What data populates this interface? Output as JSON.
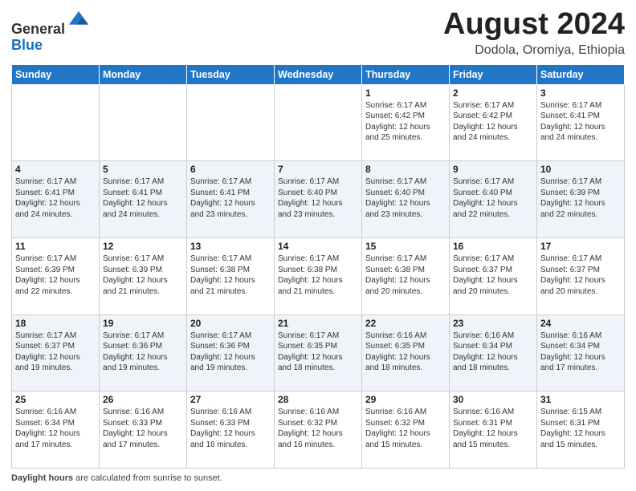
{
  "header": {
    "logo_line1": "General",
    "logo_line2": "Blue",
    "main_title": "August 2024",
    "subtitle": "Dodola, Oromiya, Ethiopia"
  },
  "weekdays": [
    "Sunday",
    "Monday",
    "Tuesday",
    "Wednesday",
    "Thursday",
    "Friday",
    "Saturday"
  ],
  "weeks": [
    [
      {
        "day": "",
        "info": ""
      },
      {
        "day": "",
        "info": ""
      },
      {
        "day": "",
        "info": ""
      },
      {
        "day": "",
        "info": ""
      },
      {
        "day": "1",
        "info": "Sunrise: 6:17 AM\nSunset: 6:42 PM\nDaylight: 12 hours\nand 25 minutes."
      },
      {
        "day": "2",
        "info": "Sunrise: 6:17 AM\nSunset: 6:42 PM\nDaylight: 12 hours\nand 24 minutes."
      },
      {
        "day": "3",
        "info": "Sunrise: 6:17 AM\nSunset: 6:41 PM\nDaylight: 12 hours\nand 24 minutes."
      }
    ],
    [
      {
        "day": "4",
        "info": "Sunrise: 6:17 AM\nSunset: 6:41 PM\nDaylight: 12 hours\nand 24 minutes."
      },
      {
        "day": "5",
        "info": "Sunrise: 6:17 AM\nSunset: 6:41 PM\nDaylight: 12 hours\nand 24 minutes."
      },
      {
        "day": "6",
        "info": "Sunrise: 6:17 AM\nSunset: 6:41 PM\nDaylight: 12 hours\nand 23 minutes."
      },
      {
        "day": "7",
        "info": "Sunrise: 6:17 AM\nSunset: 6:40 PM\nDaylight: 12 hours\nand 23 minutes."
      },
      {
        "day": "8",
        "info": "Sunrise: 6:17 AM\nSunset: 6:40 PM\nDaylight: 12 hours\nand 23 minutes."
      },
      {
        "day": "9",
        "info": "Sunrise: 6:17 AM\nSunset: 6:40 PM\nDaylight: 12 hours\nand 22 minutes."
      },
      {
        "day": "10",
        "info": "Sunrise: 6:17 AM\nSunset: 6:39 PM\nDaylight: 12 hours\nand 22 minutes."
      }
    ],
    [
      {
        "day": "11",
        "info": "Sunrise: 6:17 AM\nSunset: 6:39 PM\nDaylight: 12 hours\nand 22 minutes."
      },
      {
        "day": "12",
        "info": "Sunrise: 6:17 AM\nSunset: 6:39 PM\nDaylight: 12 hours\nand 21 minutes."
      },
      {
        "day": "13",
        "info": "Sunrise: 6:17 AM\nSunset: 6:38 PM\nDaylight: 12 hours\nand 21 minutes."
      },
      {
        "day": "14",
        "info": "Sunrise: 6:17 AM\nSunset: 6:38 PM\nDaylight: 12 hours\nand 21 minutes."
      },
      {
        "day": "15",
        "info": "Sunrise: 6:17 AM\nSunset: 6:38 PM\nDaylight: 12 hours\nand 20 minutes."
      },
      {
        "day": "16",
        "info": "Sunrise: 6:17 AM\nSunset: 6:37 PM\nDaylight: 12 hours\nand 20 minutes."
      },
      {
        "day": "17",
        "info": "Sunrise: 6:17 AM\nSunset: 6:37 PM\nDaylight: 12 hours\nand 20 minutes."
      }
    ],
    [
      {
        "day": "18",
        "info": "Sunrise: 6:17 AM\nSunset: 6:37 PM\nDaylight: 12 hours\nand 19 minutes."
      },
      {
        "day": "19",
        "info": "Sunrise: 6:17 AM\nSunset: 6:36 PM\nDaylight: 12 hours\nand 19 minutes."
      },
      {
        "day": "20",
        "info": "Sunrise: 6:17 AM\nSunset: 6:36 PM\nDaylight: 12 hours\nand 19 minutes."
      },
      {
        "day": "21",
        "info": "Sunrise: 6:17 AM\nSunset: 6:35 PM\nDaylight: 12 hours\nand 18 minutes."
      },
      {
        "day": "22",
        "info": "Sunrise: 6:16 AM\nSunset: 6:35 PM\nDaylight: 12 hours\nand 18 minutes."
      },
      {
        "day": "23",
        "info": "Sunrise: 6:16 AM\nSunset: 6:34 PM\nDaylight: 12 hours\nand 18 minutes."
      },
      {
        "day": "24",
        "info": "Sunrise: 6:16 AM\nSunset: 6:34 PM\nDaylight: 12 hours\nand 17 minutes."
      }
    ],
    [
      {
        "day": "25",
        "info": "Sunrise: 6:16 AM\nSunset: 6:34 PM\nDaylight: 12 hours\nand 17 minutes."
      },
      {
        "day": "26",
        "info": "Sunrise: 6:16 AM\nSunset: 6:33 PM\nDaylight: 12 hours\nand 17 minutes."
      },
      {
        "day": "27",
        "info": "Sunrise: 6:16 AM\nSunset: 6:33 PM\nDaylight: 12 hours\nand 16 minutes."
      },
      {
        "day": "28",
        "info": "Sunrise: 6:16 AM\nSunset: 6:32 PM\nDaylight: 12 hours\nand 16 minutes."
      },
      {
        "day": "29",
        "info": "Sunrise: 6:16 AM\nSunset: 6:32 PM\nDaylight: 12 hours\nand 15 minutes."
      },
      {
        "day": "30",
        "info": "Sunrise: 6:16 AM\nSunset: 6:31 PM\nDaylight: 12 hours\nand 15 minutes."
      },
      {
        "day": "31",
        "info": "Sunrise: 6:15 AM\nSunset: 6:31 PM\nDaylight: 12 hours\nand 15 minutes."
      }
    ]
  ],
  "footer": {
    "label": "Daylight hours",
    "text": " are calculated from sunrise to sunset."
  }
}
